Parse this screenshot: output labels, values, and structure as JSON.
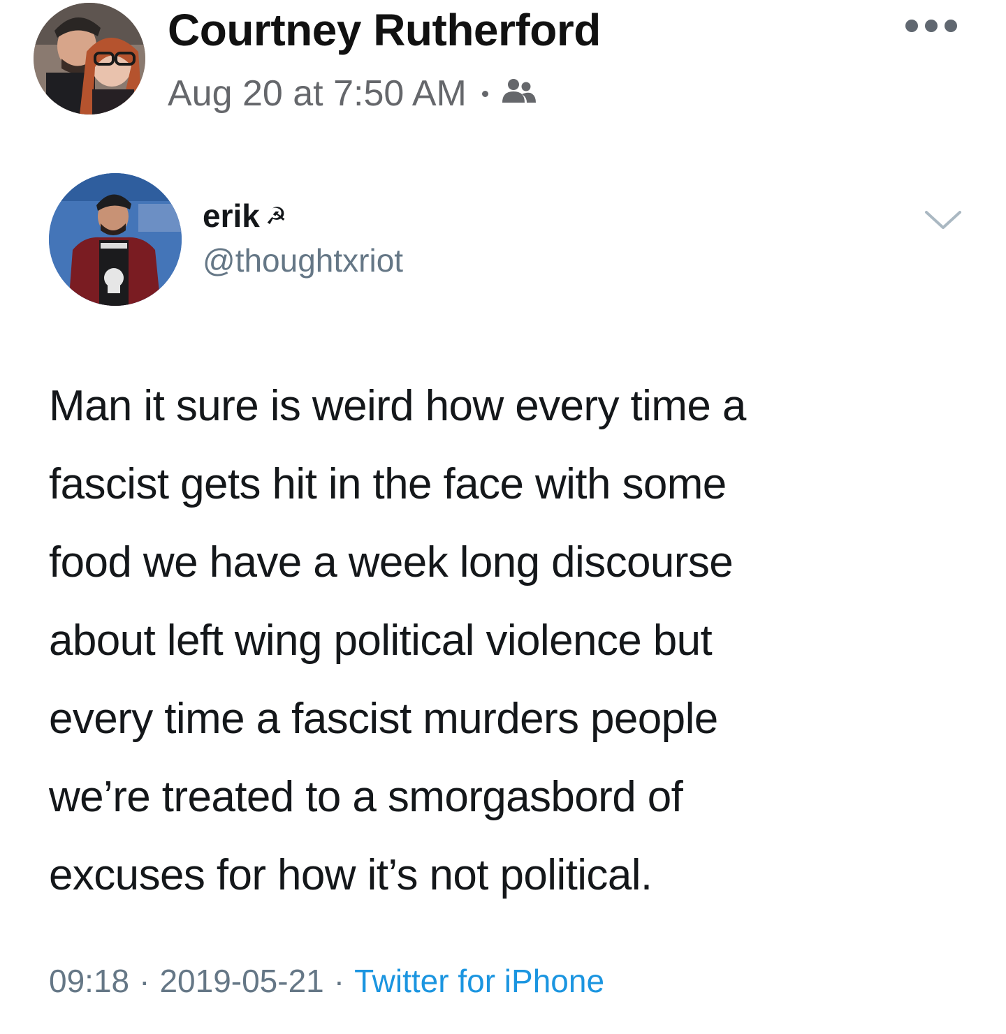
{
  "post": {
    "author_name": "Courtney Rutherford",
    "timestamp": "Aug 20 at 7:50 AM",
    "audience_icon": "friends-icon",
    "more_icon": "more-horizontal-icon"
  },
  "tweet": {
    "display_name": "erik",
    "name_emoji": "☭",
    "handle": "@thoughtxriot",
    "menu_icon": "chevron-down-icon",
    "body_lines": [
      "Man it sure is weird how every time a",
      "fascist gets hit in the face with some",
      "food we have a week long discourse",
      "about left wing political violence but",
      "every time a fascist murders people",
      "we’re treated to a smorgasbord of",
      "excuses for how it’s not political."
    ],
    "time": "09:18",
    "date": "2019-05-21",
    "separator": "·",
    "source": "Twitter for iPhone"
  },
  "colors": {
    "background": "#ffffff",
    "text_primary": "#111111",
    "text_secondary": "#65676b",
    "tweet_secondary": "#657786",
    "tweet_link": "#1b95e0"
  }
}
